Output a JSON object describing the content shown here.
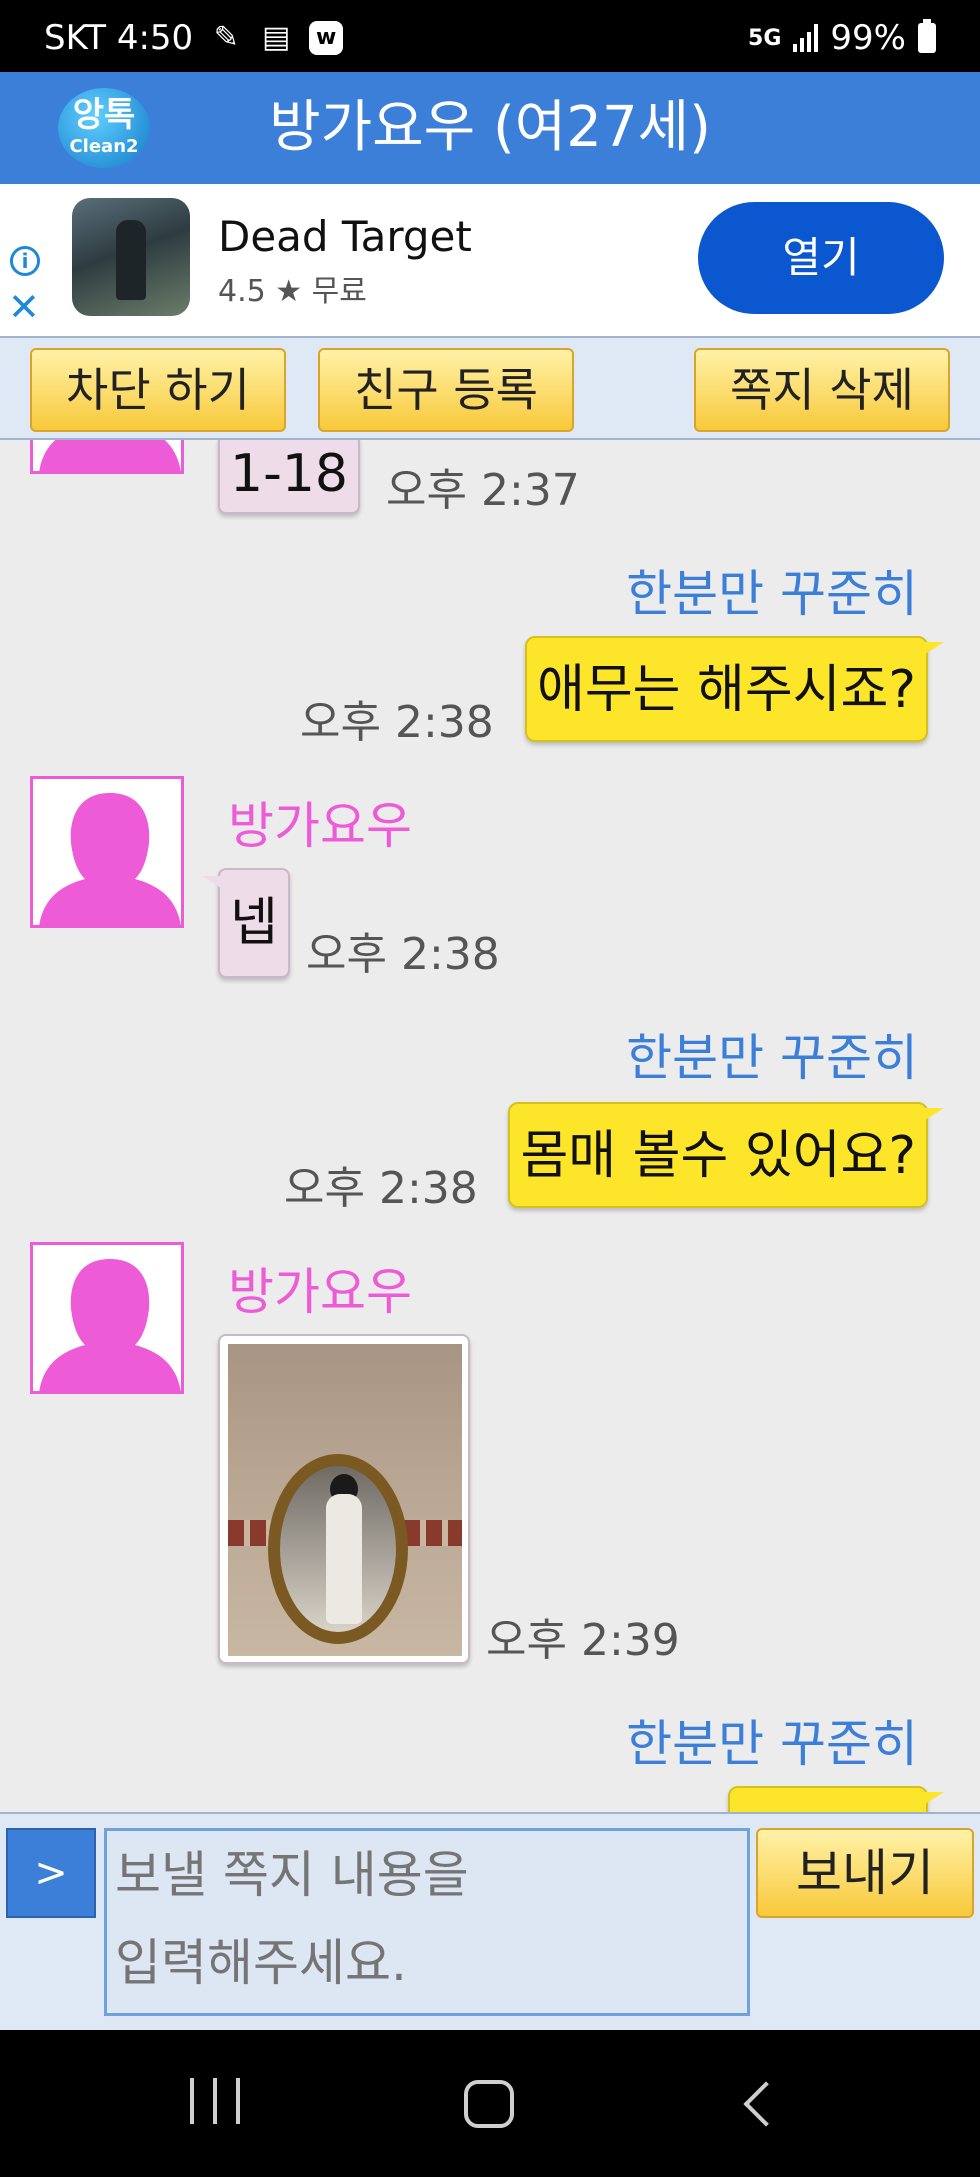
{
  "status": {
    "carrier_time": "SKT 4:50",
    "network": "5G",
    "battery": "99%"
  },
  "header": {
    "logo_main": "앙톡",
    "logo_sub": "Clean2",
    "title": "방가요우 (여27세)"
  },
  "ad": {
    "name": "Dead Target",
    "rating": "4.5 ★  무료",
    "open_label": "열기",
    "info_symbol": "i",
    "close_symbol": "✕"
  },
  "actions": {
    "block_label": "차단 하기",
    "friend_label": "친구 등록",
    "delete_label": "쪽지 삭제"
  },
  "messages": [
    {
      "text": "1-18",
      "time": "오후 2:37"
    },
    {
      "sender": "한분만 꾸준히",
      "text": "애무는 해주시죠?",
      "time": "오후 2:38"
    },
    {
      "sender": "방가요우",
      "text": "넵",
      "time": "오후 2:38"
    },
    {
      "sender": "한분만 꾸준히",
      "text": "몸매 볼수 있어요?",
      "time": "오후 2:38"
    },
    {
      "sender": "방가요우",
      "time": "오후 2:39"
    },
    {
      "sender": "한분만 꾸준히"
    }
  ],
  "input": {
    "toggle_label": ">",
    "placeholder": "보낼 쪽지 내용을\n입력해주세요.",
    "send_label": "보내기"
  },
  "colors": {
    "header_blue": "#3b7fd9",
    "my_bubble": "#fde52a",
    "their_bubble": "#eedde9",
    "female_pink": "#ee5bd6",
    "ad_button": "#0b57d0"
  }
}
